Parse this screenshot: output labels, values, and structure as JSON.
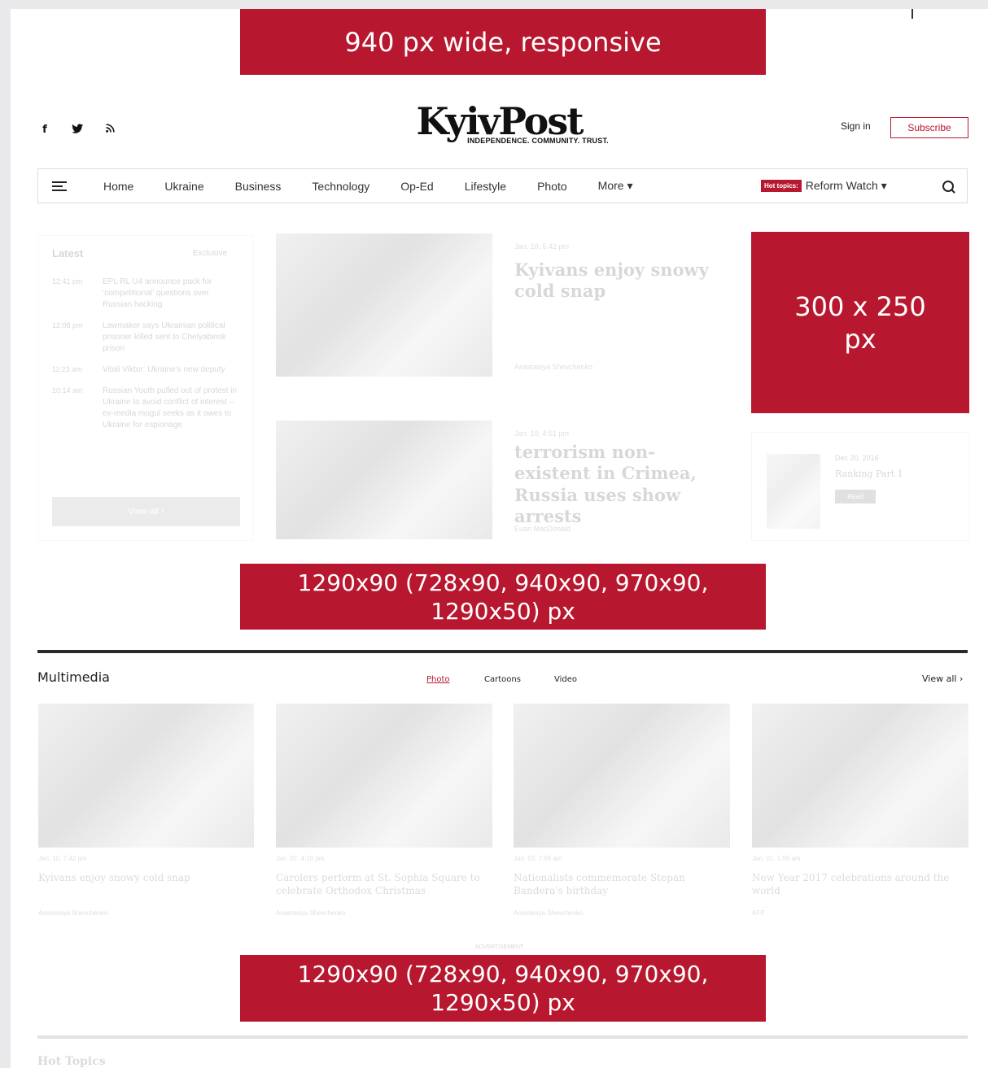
{
  "banners": {
    "top": "940 px wide, responsive",
    "side": [
      "300 x 250",
      "px"
    ],
    "leaderboard_1": [
      "1290x90 (728x90, 940x90, 970x90,",
      "1290x50) px"
    ],
    "leaderboard_2": [
      "1290x90 (728x90, 940x90, 970x90,",
      "1290x50) px"
    ]
  },
  "header": {
    "social": [
      "f",
      "☀",
      "∿"
    ],
    "social_icons": [
      "facebook-icon",
      "twitter-icon",
      "rss-icon"
    ],
    "logo": "KyivPost",
    "tagline": "INDEPENDENCE. COMMUNITY. TRUST.",
    "sign_in": "Sign in",
    "subscribe": "Subscribe"
  },
  "nav": {
    "items": [
      "Home",
      "Ukraine",
      "Business",
      "Technology",
      "Op-Ed",
      "Lifestyle",
      "Photo",
      "More ▾"
    ],
    "hot_label": "Hot topics:",
    "hot_value": "Reform Watch ▾"
  },
  "latest": {
    "title": "Latest",
    "exclusive": "Exclusive",
    "items": [
      {
        "time": "12:41 pm",
        "text": "EPL RL U4 announce pack for ‘competitional’ questions over Russian hacking"
      },
      {
        "time": "12:08 pm",
        "text": "Lawmaker says Ukrainian political prisoner killed sent to Chelyabinsk prison"
      },
      {
        "time": "11:23 am",
        "text": "Vitali Viktor: Ukraine's new deputy"
      },
      {
        "time": "10:14 am",
        "text": "Russian Youth pulled out of protest in Ukraine to avoid conflict of interest – ex-media mogul seeks as it owes to Ukraine for espionage"
      }
    ],
    "view_all": "View all ›"
  },
  "articles": [
    {
      "time": "Jan. 10, 5:42 pm",
      "title": "Kyivans enjoy snowy cold snap",
      "credit": "Anastasiya Shevchenko"
    },
    {
      "time": "Jan. 10, 4:51 pm",
      "title": "terrorism non-existent in Crimea, Russia uses show arrests",
      "credit": "Euan MacDonald"
    }
  ],
  "side_promo": {
    "time": "Dec 20, 2016",
    "title": "Ranking Part 1",
    "button": "Read"
  },
  "multimedia": {
    "title": "Multimedia",
    "tabs": [
      "Photo",
      "Cartoons",
      "Video"
    ],
    "view_all": "View all ›",
    "items": [
      {
        "time": "Jan. 10, 7:42 pm",
        "caption": "Kyivans enjoy snowy cold snap",
        "credit": "Anastasiya Shevchenko"
      },
      {
        "time": "Jan. 07, 4:10 pm",
        "caption": "Carolers perform at St. Sophia Square to celebrate Orthodox Christmas",
        "credit": "Anastasiya Shevchenko"
      },
      {
        "time": "Jan. 03, 7:56 am",
        "caption": "Nationalists commemorate Stepan Bandera's birthday",
        "credit": "Anastasiya Shevchenko"
      },
      {
        "time": "Jan. 01, 1:59 am",
        "caption": "New Year 2017 celebrations around the world",
        "credit": "AFP"
      }
    ]
  },
  "ad_label": "ADVERTISEMENT",
  "hot_topics": "Hot Topics",
  "colors": {
    "brand": "#b8182f",
    "text": "#222222",
    "border": "#dcdcdc"
  }
}
